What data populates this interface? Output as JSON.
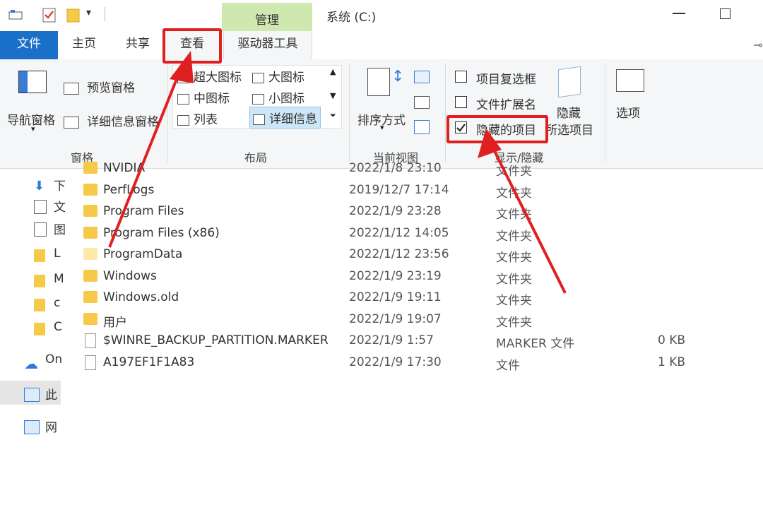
{
  "window": {
    "title": "系统 (C:)",
    "context_tab": "管理"
  },
  "tabs": {
    "file": "文件",
    "home": "主页",
    "share": "共享",
    "view": "查看",
    "drive_tools": "驱动器工具"
  },
  "ribbon": {
    "panes": {
      "nav_pane": "导航窗格",
      "preview_pane": "预览窗格",
      "details_pane": "详细信息窗格",
      "group": "窗格"
    },
    "layout": {
      "extra_large": "超大图标",
      "large": "大图标",
      "medium": "中图标",
      "small": "小图标",
      "list": "列表",
      "details": "详细信息",
      "group": "布局"
    },
    "current_view": {
      "sort_by": "排序方式",
      "group": "当前视图"
    },
    "show_hide": {
      "item_checkboxes": "项目复选框",
      "file_extensions": "文件扩展名",
      "hidden_items": "隐藏的项目",
      "hidden_items_checked": true,
      "hide_selected_line1": "隐藏",
      "hide_selected_line2": "所选项目",
      "group": "显示/隐藏"
    },
    "options": "选项"
  },
  "nav": [
    {
      "label": "下",
      "icon": "download-arrow-icon"
    },
    {
      "label": "文",
      "icon": "document-icon"
    },
    {
      "label": "图",
      "icon": "picture-icon"
    },
    {
      "label": "L",
      "icon": "folder-icon"
    },
    {
      "label": "M",
      "icon": "folder-icon"
    },
    {
      "label": "c",
      "icon": "folder-icon"
    },
    {
      "label": "C",
      "icon": "folder-icon"
    },
    {
      "label": "On",
      "icon": "cloud-icon"
    },
    {
      "label": "此",
      "icon": "computer-icon"
    },
    {
      "label": "网",
      "icon": "network-icon"
    }
  ],
  "files": [
    {
      "name": "NVIDIA",
      "date": "2022/1/8 23:10",
      "type": "文件夹",
      "size": ""
    },
    {
      "name": "PerfLogs",
      "date": "2019/12/7 17:14",
      "type": "文件夹",
      "size": ""
    },
    {
      "name": "Program Files",
      "date": "2022/1/9 23:28",
      "type": "文件夹",
      "size": ""
    },
    {
      "name": "Program Files (x86)",
      "date": "2022/1/12 14:05",
      "type": "文件夹",
      "size": ""
    },
    {
      "name": "ProgramData",
      "date": "2022/1/12 23:56",
      "type": "文件夹",
      "size": ""
    },
    {
      "name": "Windows",
      "date": "2022/1/9 23:19",
      "type": "文件夹",
      "size": ""
    },
    {
      "name": "Windows.old",
      "date": "2022/1/9 19:11",
      "type": "文件夹",
      "size": ""
    },
    {
      "name": "用户",
      "date": "2022/1/9 19:07",
      "type": "文件夹",
      "size": ""
    },
    {
      "name": "$WINRE_BACKUP_PARTITION.MARKER",
      "date": "2022/1/9 1:57",
      "type": "MARKER 文件",
      "size": "0 KB"
    },
    {
      "name": "A197EF1F1A83",
      "date": "2022/1/9 17:30",
      "type": "文件",
      "size": "1 KB"
    }
  ],
  "colors": {
    "file_tab": "#1a6fc9",
    "manage_tab": "#cfe8b0",
    "annotation": "#e02020",
    "folder": "#f7c948"
  }
}
